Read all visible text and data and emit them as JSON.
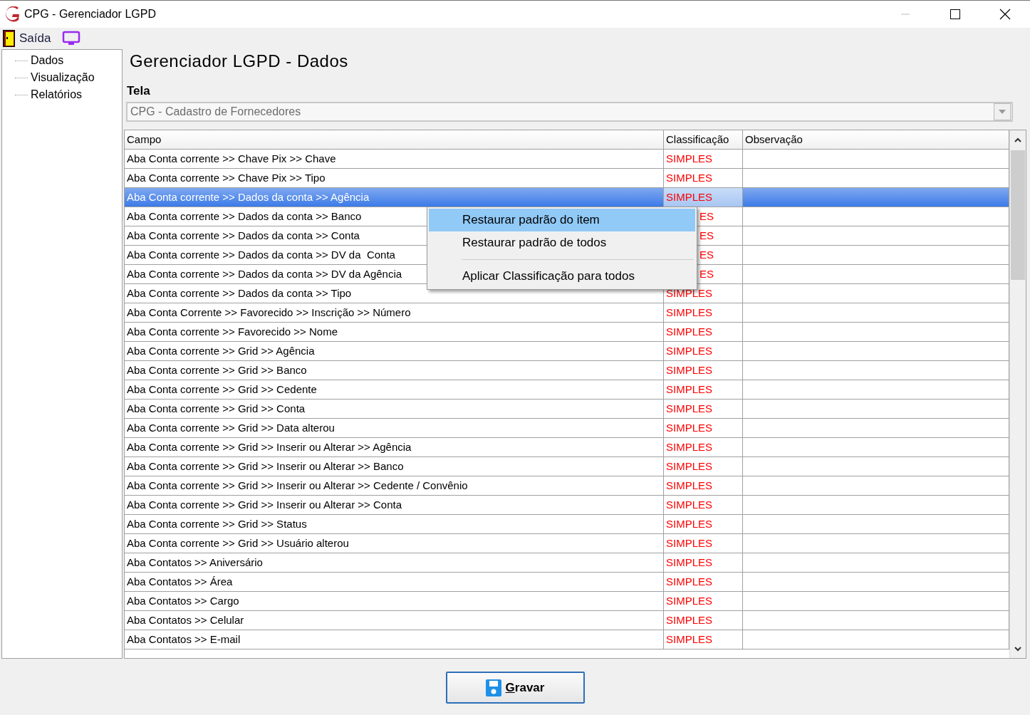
{
  "window": {
    "title": "CPG - Gerenciador LGPD"
  },
  "toolbar": {
    "exit_label": "Saída"
  },
  "sidebar": {
    "items": [
      {
        "label": "Dados"
      },
      {
        "label": "Visualização"
      },
      {
        "label": "Relatórios"
      }
    ]
  },
  "heading": "Gerenciador LGPD - Dados",
  "tela": {
    "label": "Tela",
    "value": "CPG - Cadastro de Fornecedores",
    "disabled": true
  },
  "table": {
    "columns": [
      "Campo",
      "Classificação",
      "Observação"
    ],
    "rows": [
      {
        "campo": "Aba Conta corrente >> Chave Pix >> Chave",
        "classificacao": "SIMPLES",
        "selected": false
      },
      {
        "campo": "Aba Conta corrente >> Chave Pix >> Tipo",
        "classificacao": "SIMPLES",
        "selected": false
      },
      {
        "campo": "Aba Conta corrente >> Dados da conta >> Agência",
        "classificacao": "SIMPLES",
        "selected": true
      },
      {
        "campo": "Aba Conta corrente >> Dados da conta >> Banco",
        "classificacao": "ES",
        "selected": false
      },
      {
        "campo": "Aba Conta corrente >> Dados da conta >> Conta",
        "classificacao": "ES",
        "selected": false
      },
      {
        "campo": "Aba Conta corrente >> Dados da conta >> DV da  Conta",
        "classificacao": "ES",
        "selected": false
      },
      {
        "campo": "Aba Conta corrente >> Dados da conta >> DV da Agência",
        "classificacao": "ES",
        "selected": false
      },
      {
        "campo": "Aba Conta corrente >> Dados da conta >> Tipo",
        "classificacao": "SIMPLES",
        "selected": false
      },
      {
        "campo": "Aba Conta Corrente >> Favorecido >> Inscrição >> Número",
        "classificacao": "SIMPLES",
        "selected": false
      },
      {
        "campo": "Aba Conta corrente >> Favorecido >> Nome",
        "classificacao": "SIMPLES",
        "selected": false
      },
      {
        "campo": "Aba Conta corrente >> Grid >> Agência",
        "classificacao": "SIMPLES",
        "selected": false
      },
      {
        "campo": "Aba Conta corrente >> Grid >> Banco",
        "classificacao": "SIMPLES",
        "selected": false
      },
      {
        "campo": "Aba Conta corrente >> Grid >> Cedente",
        "classificacao": "SIMPLES",
        "selected": false
      },
      {
        "campo": "Aba Conta corrente >> Grid >> Conta",
        "classificacao": "SIMPLES",
        "selected": false
      },
      {
        "campo": "Aba Conta corrente >> Grid >> Data alterou",
        "classificacao": "SIMPLES",
        "selected": false
      },
      {
        "campo": "Aba Conta corrente >> Grid >> Inserir ou Alterar >> Agência",
        "classificacao": "SIMPLES",
        "selected": false
      },
      {
        "campo": "Aba Conta corrente >> Grid >> Inserir ou Alterar >> Banco",
        "classificacao": "SIMPLES",
        "selected": false
      },
      {
        "campo": "Aba Conta corrente >> Grid >> Inserir ou Alterar >> Cedente / Convênio",
        "classificacao": "SIMPLES",
        "selected": false
      },
      {
        "campo": "Aba Conta corrente >> Grid >> Inserir ou Alterar >> Conta",
        "classificacao": "SIMPLES",
        "selected": false
      },
      {
        "campo": "Aba Conta corrente >> Grid >> Status",
        "classificacao": "SIMPLES",
        "selected": false
      },
      {
        "campo": "Aba Conta corrente >> Grid >> Usuário alterou",
        "classificacao": "SIMPLES",
        "selected": false
      },
      {
        "campo": "Aba Contatos >> Aniversário",
        "classificacao": "SIMPLES",
        "selected": false
      },
      {
        "campo": "Aba Contatos >> Área",
        "classificacao": "SIMPLES",
        "selected": false
      },
      {
        "campo": "Aba Contatos >> Cargo",
        "classificacao": "SIMPLES",
        "selected": false
      },
      {
        "campo": "Aba Contatos >> Celular",
        "classificacao": "SIMPLES",
        "selected": false
      },
      {
        "campo": "Aba Contatos >> E-mail",
        "classificacao": "SIMPLES",
        "selected": false
      }
    ]
  },
  "context_menu": {
    "items": [
      {
        "label": "Restaurar padrão do item",
        "selected": true
      },
      {
        "label": "Restaurar padrão de todos",
        "selected": false
      },
      {
        "kind": "separator"
      },
      {
        "label": "Aplicar Classificação para todos",
        "selected": false
      }
    ]
  },
  "buttons": [
    {
      "label": "Gravar"
    }
  ]
}
